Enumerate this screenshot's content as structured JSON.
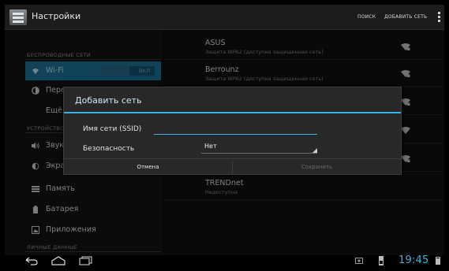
{
  "actionbar": {
    "title": "Настройки",
    "search_label": "ПОИСК",
    "add_network_label": "ДОБАВИТЬ СЕТЬ"
  },
  "sidebar": {
    "wireless_header": "БЕСПРОВОДНЫЕ СЕТИ",
    "device_header": "УСТРОЙСТВО",
    "personal_header": "ЛИЧНЫЕ ДАННЫЕ",
    "items": [
      {
        "label": "Wi-Fi",
        "icon": "wifi-icon",
        "toggle": "ВКЛ"
      },
      {
        "label": "Передача данных",
        "icon": "data-usage-icon"
      },
      {
        "label": "Ещё...",
        "icon": ""
      },
      {
        "label": "Звук",
        "icon": "sound-icon"
      },
      {
        "label": "Экран",
        "icon": "display-icon"
      },
      {
        "label": "Память",
        "icon": "storage-icon"
      },
      {
        "label": "Батарея",
        "icon": "battery-icon"
      },
      {
        "label": "Приложения",
        "icon": "apps-icon"
      }
    ]
  },
  "networks": [
    {
      "name": "ASUS",
      "desc": "Защита WPA2 (доступна защищенная сеть)"
    },
    {
      "name": "Berrounz",
      "desc": "Защита WPA2 (доступна защищенная сеть)"
    },
    {
      "name": "",
      "desc": ""
    },
    {
      "name": "",
      "desc": ""
    },
    {
      "name": "",
      "desc": ""
    },
    {
      "name": "TRENDnet",
      "desc": "Недоступна"
    }
  ],
  "dialog": {
    "title": "Добавить сеть",
    "ssid_label": "Имя сети (SSID)",
    "ssid_value": "",
    "security_label": "Безопасность",
    "security_value": "Нет",
    "cancel_label": "Отмена",
    "save_label": "Сохранить"
  },
  "status": {
    "clock": "19:45"
  },
  "colors": {
    "accent": "#33b5e5",
    "selected": "#1f7aa0"
  }
}
